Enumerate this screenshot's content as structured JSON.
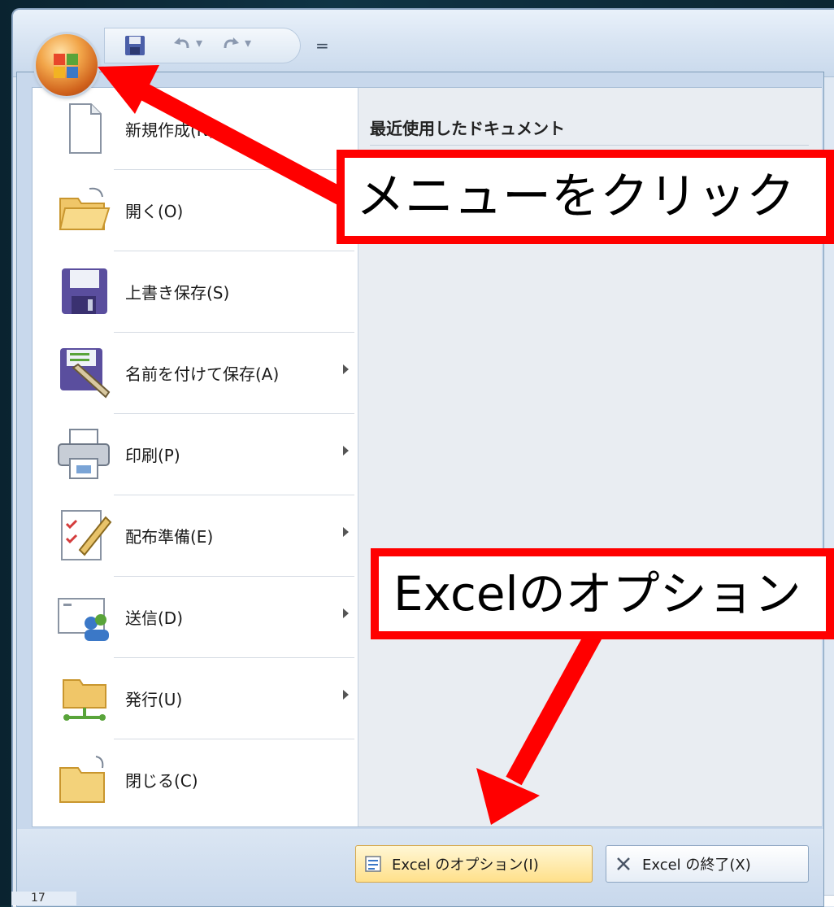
{
  "quick_access": {
    "save_icon": "floppy-save-icon",
    "undo_icon": "undo-icon",
    "redo_icon": "redo-icon",
    "customize_label": "="
  },
  "office_button": {
    "icon": "office-orb-icon"
  },
  "menu": {
    "commands": [
      {
        "label": "新規作成(N)",
        "icon": "new-document-icon",
        "has_submenu": false
      },
      {
        "label": "開く(O)",
        "icon": "open-folder-icon",
        "has_submenu": false
      },
      {
        "label": "上書き保存(S)",
        "icon": "save-icon",
        "has_submenu": false
      },
      {
        "label": "名前を付けて保存(A)",
        "icon": "save-as-icon",
        "has_submenu": true
      },
      {
        "label": "印刷(P)",
        "icon": "printer-icon",
        "has_submenu": true
      },
      {
        "label": "配布準備(E)",
        "icon": "prepare-icon",
        "has_submenu": true
      },
      {
        "label": "送信(D)",
        "icon": "send-icon",
        "has_submenu": true
      },
      {
        "label": "発行(U)",
        "icon": "publish-icon",
        "has_submenu": true
      },
      {
        "label": "閉じる(C)",
        "icon": "close-folder-icon",
        "has_submenu": false
      }
    ],
    "recent_title": "最近使用したドキュメント",
    "footer": {
      "options_label": "Excel のオプション(I)",
      "exit_label": "Excel の終了(X)"
    }
  },
  "grid": {
    "row_label": "17"
  },
  "annotations": {
    "callout_1": "メニューをクリック",
    "callout_2": "Excelのオプション"
  },
  "colors": {
    "annotation_red": "#ff0000",
    "menu_bg": "#ffffff",
    "recent_bg": "#e9edf2"
  }
}
